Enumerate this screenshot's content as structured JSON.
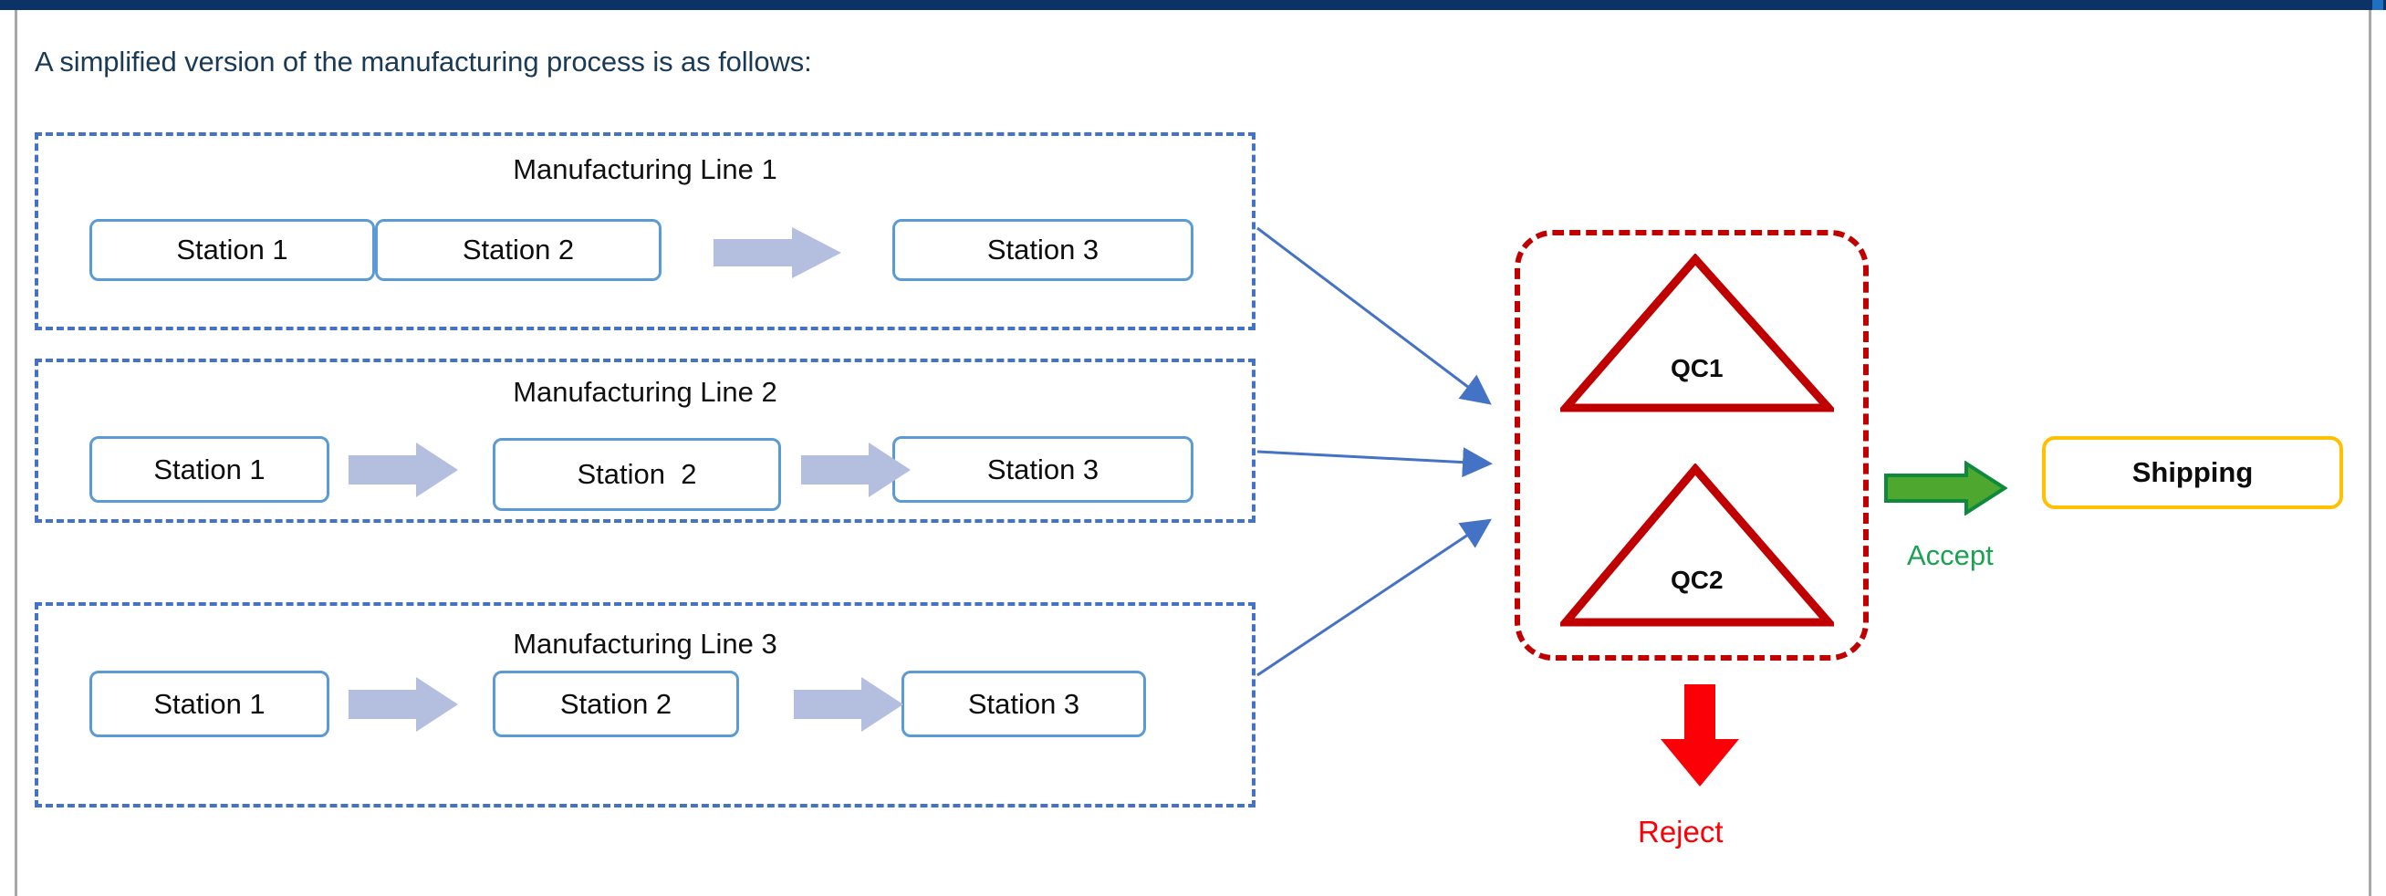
{
  "caption": "A simplified version of the manufacturing process is as follows:",
  "colors": {
    "line_border": "#4472c4",
    "station_border": "#5b9bd5",
    "chevron_arrow": "#b4bfe0",
    "connector": "#4472c4",
    "qc_border": "#c00000",
    "qc_triangle": "#c00000",
    "accept_arrow_fill": "#4ea72e",
    "accept_arrow_stroke": "#0f8a3c",
    "accept_text": "#1aa251",
    "reject_arrow": "#fb0007",
    "reject_text": "#fb0007",
    "shipping_border": "#ffc000",
    "caption_text": "#1b3a56",
    "titlebar": "#0c3367",
    "titlebar_accent": "#1f70c1"
  },
  "lines": [
    {
      "title": "Manufacturing Line 1",
      "stations": [
        "Station 1",
        "Station 2",
        "Station 3"
      ]
    },
    {
      "title": "Manufacturing Line 2",
      "stations": [
        "Station 1",
        "Station  2",
        "Station 3"
      ]
    },
    {
      "title": "Manufacturing Line 3",
      "stations": [
        "Station 1",
        "Station 2",
        "Station 3"
      ]
    }
  ],
  "qc": {
    "items": [
      "QC1",
      "QC2"
    ]
  },
  "outcomes": {
    "accept": "Accept",
    "reject": "Reject",
    "shipping": "Shipping"
  }
}
